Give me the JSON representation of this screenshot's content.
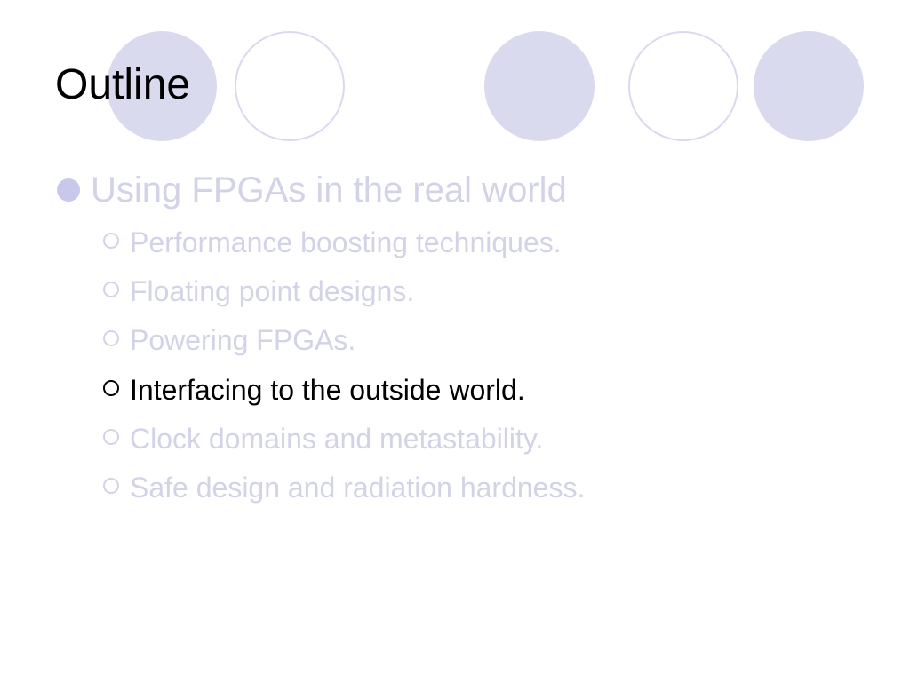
{
  "slide": {
    "title": "Outline",
    "colors": {
      "circle": "#dadaee",
      "bullet": "#c8c8ec",
      "dimmed_text": "#d3d3e8",
      "active_text": "#000000"
    },
    "main_item": {
      "text": "Using FPGAs in the real world",
      "active": false
    },
    "sub_items": [
      {
        "text": "Performance boosting techniques.",
        "active": false
      },
      {
        "text": "Floating point designs.",
        "active": false
      },
      {
        "text": "Powering FPGAs.",
        "active": false
      },
      {
        "text": "Interfacing to the outside world.",
        "active": true
      },
      {
        "text": "Clock domains and metastability.",
        "active": false
      },
      {
        "text": "Safe design and radiation hardness.",
        "active": false
      }
    ]
  }
}
